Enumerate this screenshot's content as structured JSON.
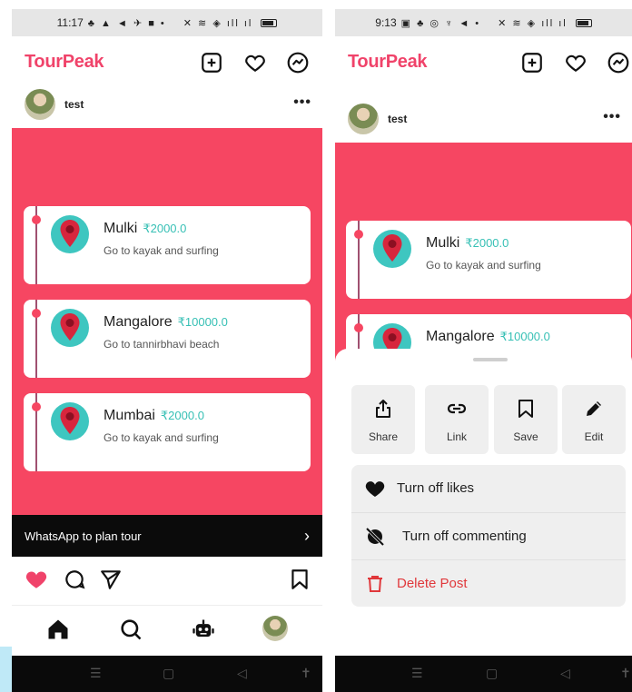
{
  "left_phone": {
    "status": {
      "time": "11:17",
      "icons_left": "♣ ▲ ◄ ✈ ■ •",
      "icons_right": "✕ ≋ ◈ ıll ıl"
    },
    "app_title": "TourPeak",
    "post_user": "test",
    "more": "•••",
    "itinerary": [
      {
        "place": "Mulki",
        "price": "₹2000.0",
        "desc": "Go to kayak and surfing"
      },
      {
        "place": "Mangalore",
        "price": "₹10000.0",
        "desc": "Go to tannirbhavi beach"
      },
      {
        "place": "Mumbai",
        "price": "₹2000.0",
        "desc": "Go to kayak and surfing"
      }
    ],
    "whatsapp": {
      "label": "WhatsApp to plan tour",
      "arrow": "›"
    }
  },
  "right_phone": {
    "status": {
      "time": "9:13",
      "icons_left": "▣ ♣ ◎ ♆ ◄ •",
      "icons_right": "✕ ≋ ◈ ıll ıl"
    },
    "app_title": "TourPeak",
    "post_user": "test",
    "more": "•••",
    "itinerary": [
      {
        "place": "Mulki",
        "price": "₹2000.0",
        "desc": "Go to kayak and surfing"
      },
      {
        "place": "Mangalore",
        "price": "₹10000.0",
        "desc": ""
      }
    ],
    "sheet": {
      "tiles": [
        {
          "label": "Share",
          "icon": "share-icon"
        },
        {
          "label": "Link",
          "icon": "link-icon"
        },
        {
          "label": "Save",
          "icon": "bookmark-icon"
        },
        {
          "label": "Edit",
          "icon": "pencil-icon"
        }
      ],
      "menu": [
        {
          "label": "Turn off likes",
          "icon": "heart-filled-icon"
        },
        {
          "label": "Turn off commenting",
          "icon": "comment-off-icon"
        },
        {
          "label": "Delete Post",
          "icon": "trash-icon",
          "color": "#e0383b"
        }
      ]
    }
  },
  "sysnav_glyphs": {
    "menu": "☰",
    "home": "▢",
    "back": "◁",
    "access": "✝"
  },
  "colors": {
    "brand": "#f0436a",
    "post_bg": "#f64662",
    "pin": "#3ec6c0",
    "price": "#37c0b5",
    "danger": "#e0383b"
  }
}
